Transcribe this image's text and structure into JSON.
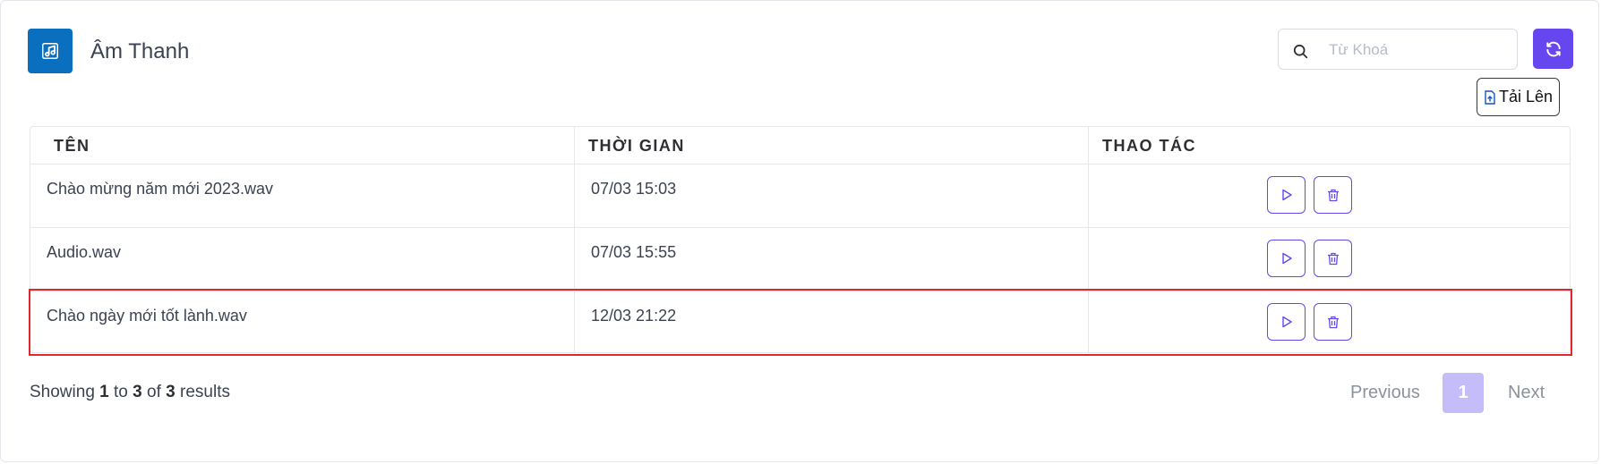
{
  "header": {
    "title": "Âm Thanh",
    "icon": "music-note-icon",
    "accent_color": "#0a6fbf"
  },
  "search": {
    "placeholder": "Từ Khoá",
    "value": ""
  },
  "toolbar": {
    "refresh_icon": "refresh-icon",
    "refresh_color": "#6646ee",
    "upload_label": "Tải Lên",
    "upload_icon": "file-upload-icon"
  },
  "table": {
    "columns": [
      "TÊN",
      "THỜI GIAN",
      "THAO TÁC"
    ],
    "rows": [
      {
        "name": "Chào mừng năm mới 2023.wav",
        "time": "07/03 15:03"
      },
      {
        "name": "Audio.wav",
        "time": "07/03 15:55"
      },
      {
        "name": "Chào ngày mới tốt lành.wav",
        "time": "12/03 21:22"
      }
    ],
    "actions": [
      "play-icon",
      "trash-icon"
    ],
    "highlight_color": "#e1262d"
  },
  "pagination": {
    "showing_prefix": "Showing",
    "from": "1",
    "to_word": "to",
    "to": "3",
    "of_word": "of",
    "total": "3",
    "results_word": "results",
    "previous_label": "Previous",
    "current_page": "1",
    "next_label": "Next"
  }
}
